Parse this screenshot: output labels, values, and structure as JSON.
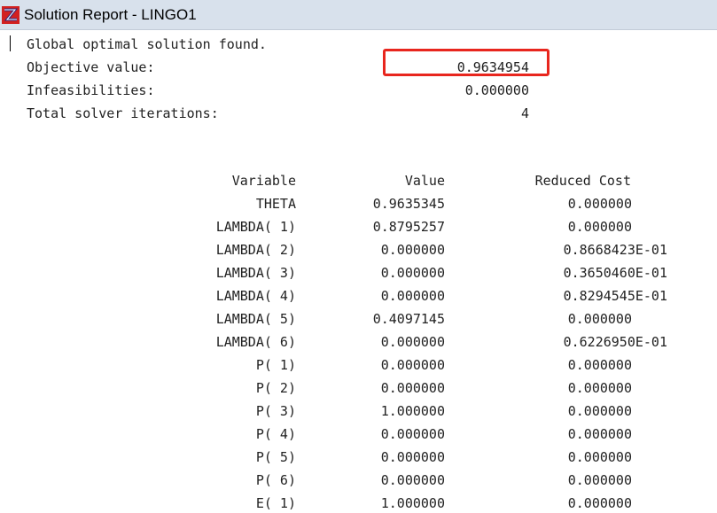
{
  "window": {
    "title": "Solution Report - LINGO1"
  },
  "summary": {
    "status": "Global optimal solution found.",
    "objective_label": "Objective value:",
    "objective_value": "0.9634954",
    "infeasibilities_label": "Infeasibilities:",
    "infeasibilities_value": "0.000000",
    "iterations_label": "Total solver iterations:",
    "iterations_value": "4"
  },
  "table": {
    "headers": {
      "variable": "Variable",
      "value": "Value",
      "reduced_cost": "Reduced Cost"
    },
    "rows": [
      {
        "variable": "THETA",
        "value": "0.9635345",
        "reduced_cost": "0.000000"
      },
      {
        "variable": "LAMBDA( 1)",
        "value": "0.8795257",
        "reduced_cost": "0.000000"
      },
      {
        "variable": "LAMBDA( 2)",
        "value": "0.000000",
        "reduced_cost": "0.8668423E-01"
      },
      {
        "variable": "LAMBDA( 3)",
        "value": "0.000000",
        "reduced_cost": "0.3650460E-01"
      },
      {
        "variable": "LAMBDA( 4)",
        "value": "0.000000",
        "reduced_cost": "0.8294545E-01"
      },
      {
        "variable": "LAMBDA( 5)",
        "value": "0.4097145",
        "reduced_cost": "0.000000"
      },
      {
        "variable": "LAMBDA( 6)",
        "value": "0.000000",
        "reduced_cost": "0.6226950E-01"
      },
      {
        "variable": "P( 1)",
        "value": "0.000000",
        "reduced_cost": "0.000000"
      },
      {
        "variable": "P( 2)",
        "value": "0.000000",
        "reduced_cost": "0.000000"
      },
      {
        "variable": "P( 3)",
        "value": "1.000000",
        "reduced_cost": "0.000000"
      },
      {
        "variable": "P( 4)",
        "value": "0.000000",
        "reduced_cost": "0.000000"
      },
      {
        "variable": "P( 5)",
        "value": "0.000000",
        "reduced_cost": "0.000000"
      },
      {
        "variable": "P( 6)",
        "value": "0.000000",
        "reduced_cost": "0.000000"
      },
      {
        "variable": "E( 1)",
        "value": "1.000000",
        "reduced_cost": "0.000000"
      }
    ]
  },
  "colors": {
    "titlebar": "#d8e1ec",
    "highlight": "#e8261e",
    "text": "#222222"
  },
  "icons": {
    "app": "lingo-app-icon"
  }
}
